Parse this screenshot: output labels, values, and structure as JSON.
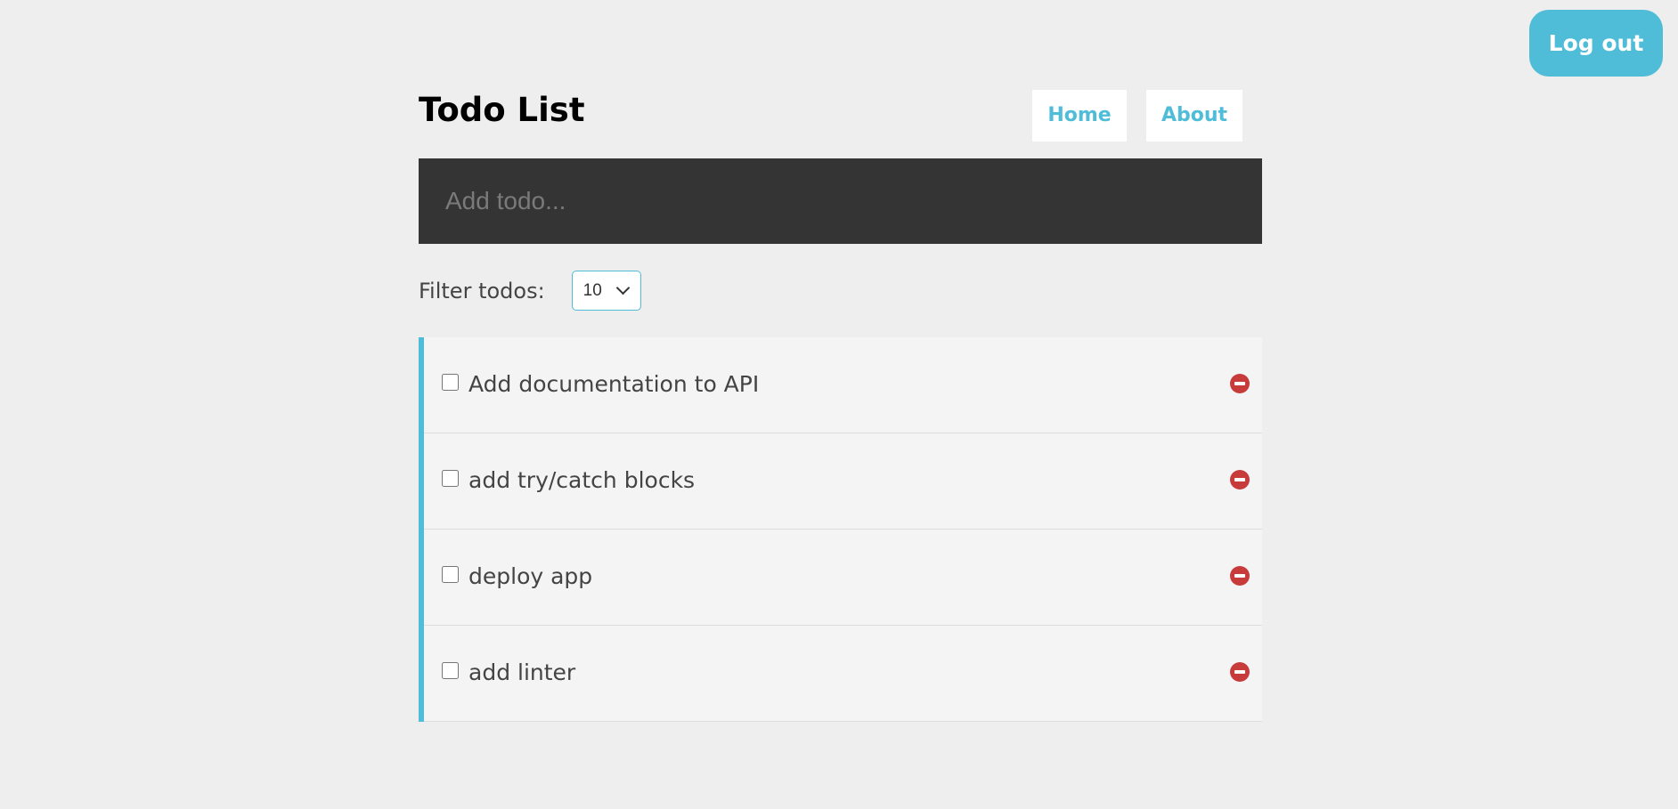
{
  "header": {
    "title": "Todo List",
    "nav": {
      "home": "Home",
      "about": "About"
    },
    "logout_label": "Log out"
  },
  "add_todo": {
    "placeholder": "Add todo...",
    "value": ""
  },
  "filter": {
    "label": "Filter todos:",
    "selected": "10"
  },
  "todos": [
    {
      "text": "Add documentation to API",
      "completed": false
    },
    {
      "text": "add try/catch blocks",
      "completed": false
    },
    {
      "text": "deploy app",
      "completed": false
    },
    {
      "text": "add linter",
      "completed": false
    }
  ],
  "colors": {
    "accent": "#4fbcd8",
    "input_bg": "#333433",
    "delete": "#c73b3b",
    "page_bg": "#eeeeee"
  },
  "icons": {
    "delete": "minus-circle-icon",
    "filter_dropdown": "chevron-down-icon"
  }
}
